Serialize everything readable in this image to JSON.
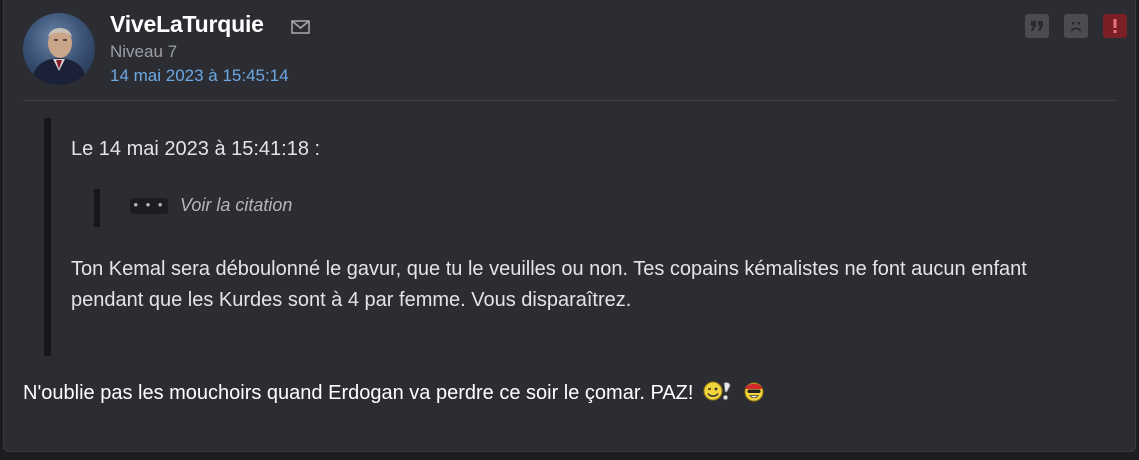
{
  "post": {
    "author": {
      "username": "ViveLaTurquie",
      "level": "Niveau 7",
      "avatar_icon": "avatar-image",
      "message_icon": "envelope-icon"
    },
    "date": "14 mai 2023 à 15:45:14",
    "actions": [
      {
        "name": "quote",
        "icon": "quote-icon"
      },
      {
        "name": "ignore",
        "icon": "sad-face-icon"
      },
      {
        "name": "report",
        "icon": "exclamation-icon"
      }
    ],
    "quote": {
      "header": "Le 14 mai 2023 à 15:41:18 :",
      "nested_toggle": "• • •",
      "nested_label": "Voir la citation",
      "body": "Ton Kemal sera déboulonné le gavur, que tu le veuilles ou non. Tes copains kémalistes ne font aucun enfant pendant que les Kurdes sont à 4 par femme. Vous disparaîtrez."
    },
    "message": {
      "text": "N'oublie pas les mouchoirs quand Erdogan va perdre ce soir le çomar. PAZ!",
      "smileys": [
        "wink-smiley-icon",
        "pirate-smiley-icon"
      ]
    },
    "colors": {
      "background": "#2c2d32",
      "date_link": "#6ba8e6",
      "report_button": "#7a1f26",
      "quote_border": "#161719"
    }
  }
}
